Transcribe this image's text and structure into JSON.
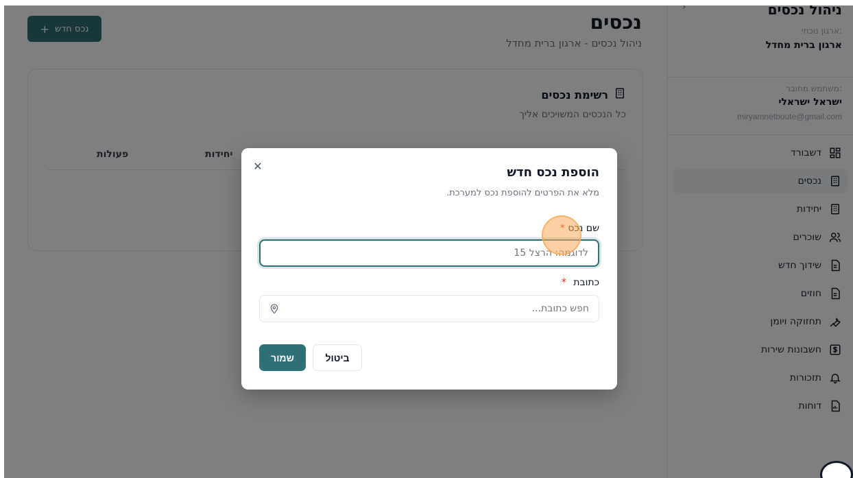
{
  "sidebar": {
    "title": "ניהול נכסים",
    "org_label": "ארגון נוכחי:",
    "org_name": "ארגון ברית מחדל",
    "user_label": "משתמש מחובר:",
    "user_name": "ישראל ישראלי",
    "user_email": "miryamnetboute@gmail.com",
    "items": [
      {
        "label": "דשבורד",
        "icon": "dashboard-icon"
      },
      {
        "label": "נכסים",
        "icon": "building-icon",
        "active": true
      },
      {
        "label": "יחידות",
        "icon": "building-icon"
      },
      {
        "label": "שוכרים",
        "icon": "users-icon"
      },
      {
        "label": "שידוך חדש",
        "icon": "document-icon"
      },
      {
        "label": "חוזים",
        "icon": "document-icon"
      },
      {
        "label": "תחזוקה ויומן",
        "icon": "wrench-icon"
      },
      {
        "label": "חשבונות שירות",
        "icon": "dollar-icon"
      },
      {
        "label": "תזכורות",
        "icon": "bell-icon"
      },
      {
        "label": "דוחות",
        "icon": "report-icon"
      }
    ]
  },
  "main": {
    "title": "נכסים",
    "subtitle": "ניהול נכסים - ארגון ברית מחדל",
    "add_button": "נכס חדש",
    "card": {
      "title": "רשימת נכסים",
      "subtitle": "כל הנכסים המשויכים אליך",
      "columns": [
        "יחידות",
        "פעולות"
      ]
    }
  },
  "modal": {
    "title": "הוספת נכס חדש",
    "description": "מלא את הפרטים להוספת נכס למערכת.",
    "name_label": "שם נכס",
    "name_placeholder": "לדוגמה: הרצל 15",
    "address_label": "כתובת",
    "address_placeholder": "חפש כתובת...",
    "required_mark": "*",
    "save": "שמור",
    "cancel": "ביטול"
  },
  "colors": {
    "primary": "#2f6f76",
    "required": "#dc2626",
    "overlay": "rgba(0,0,0,0.5)"
  }
}
